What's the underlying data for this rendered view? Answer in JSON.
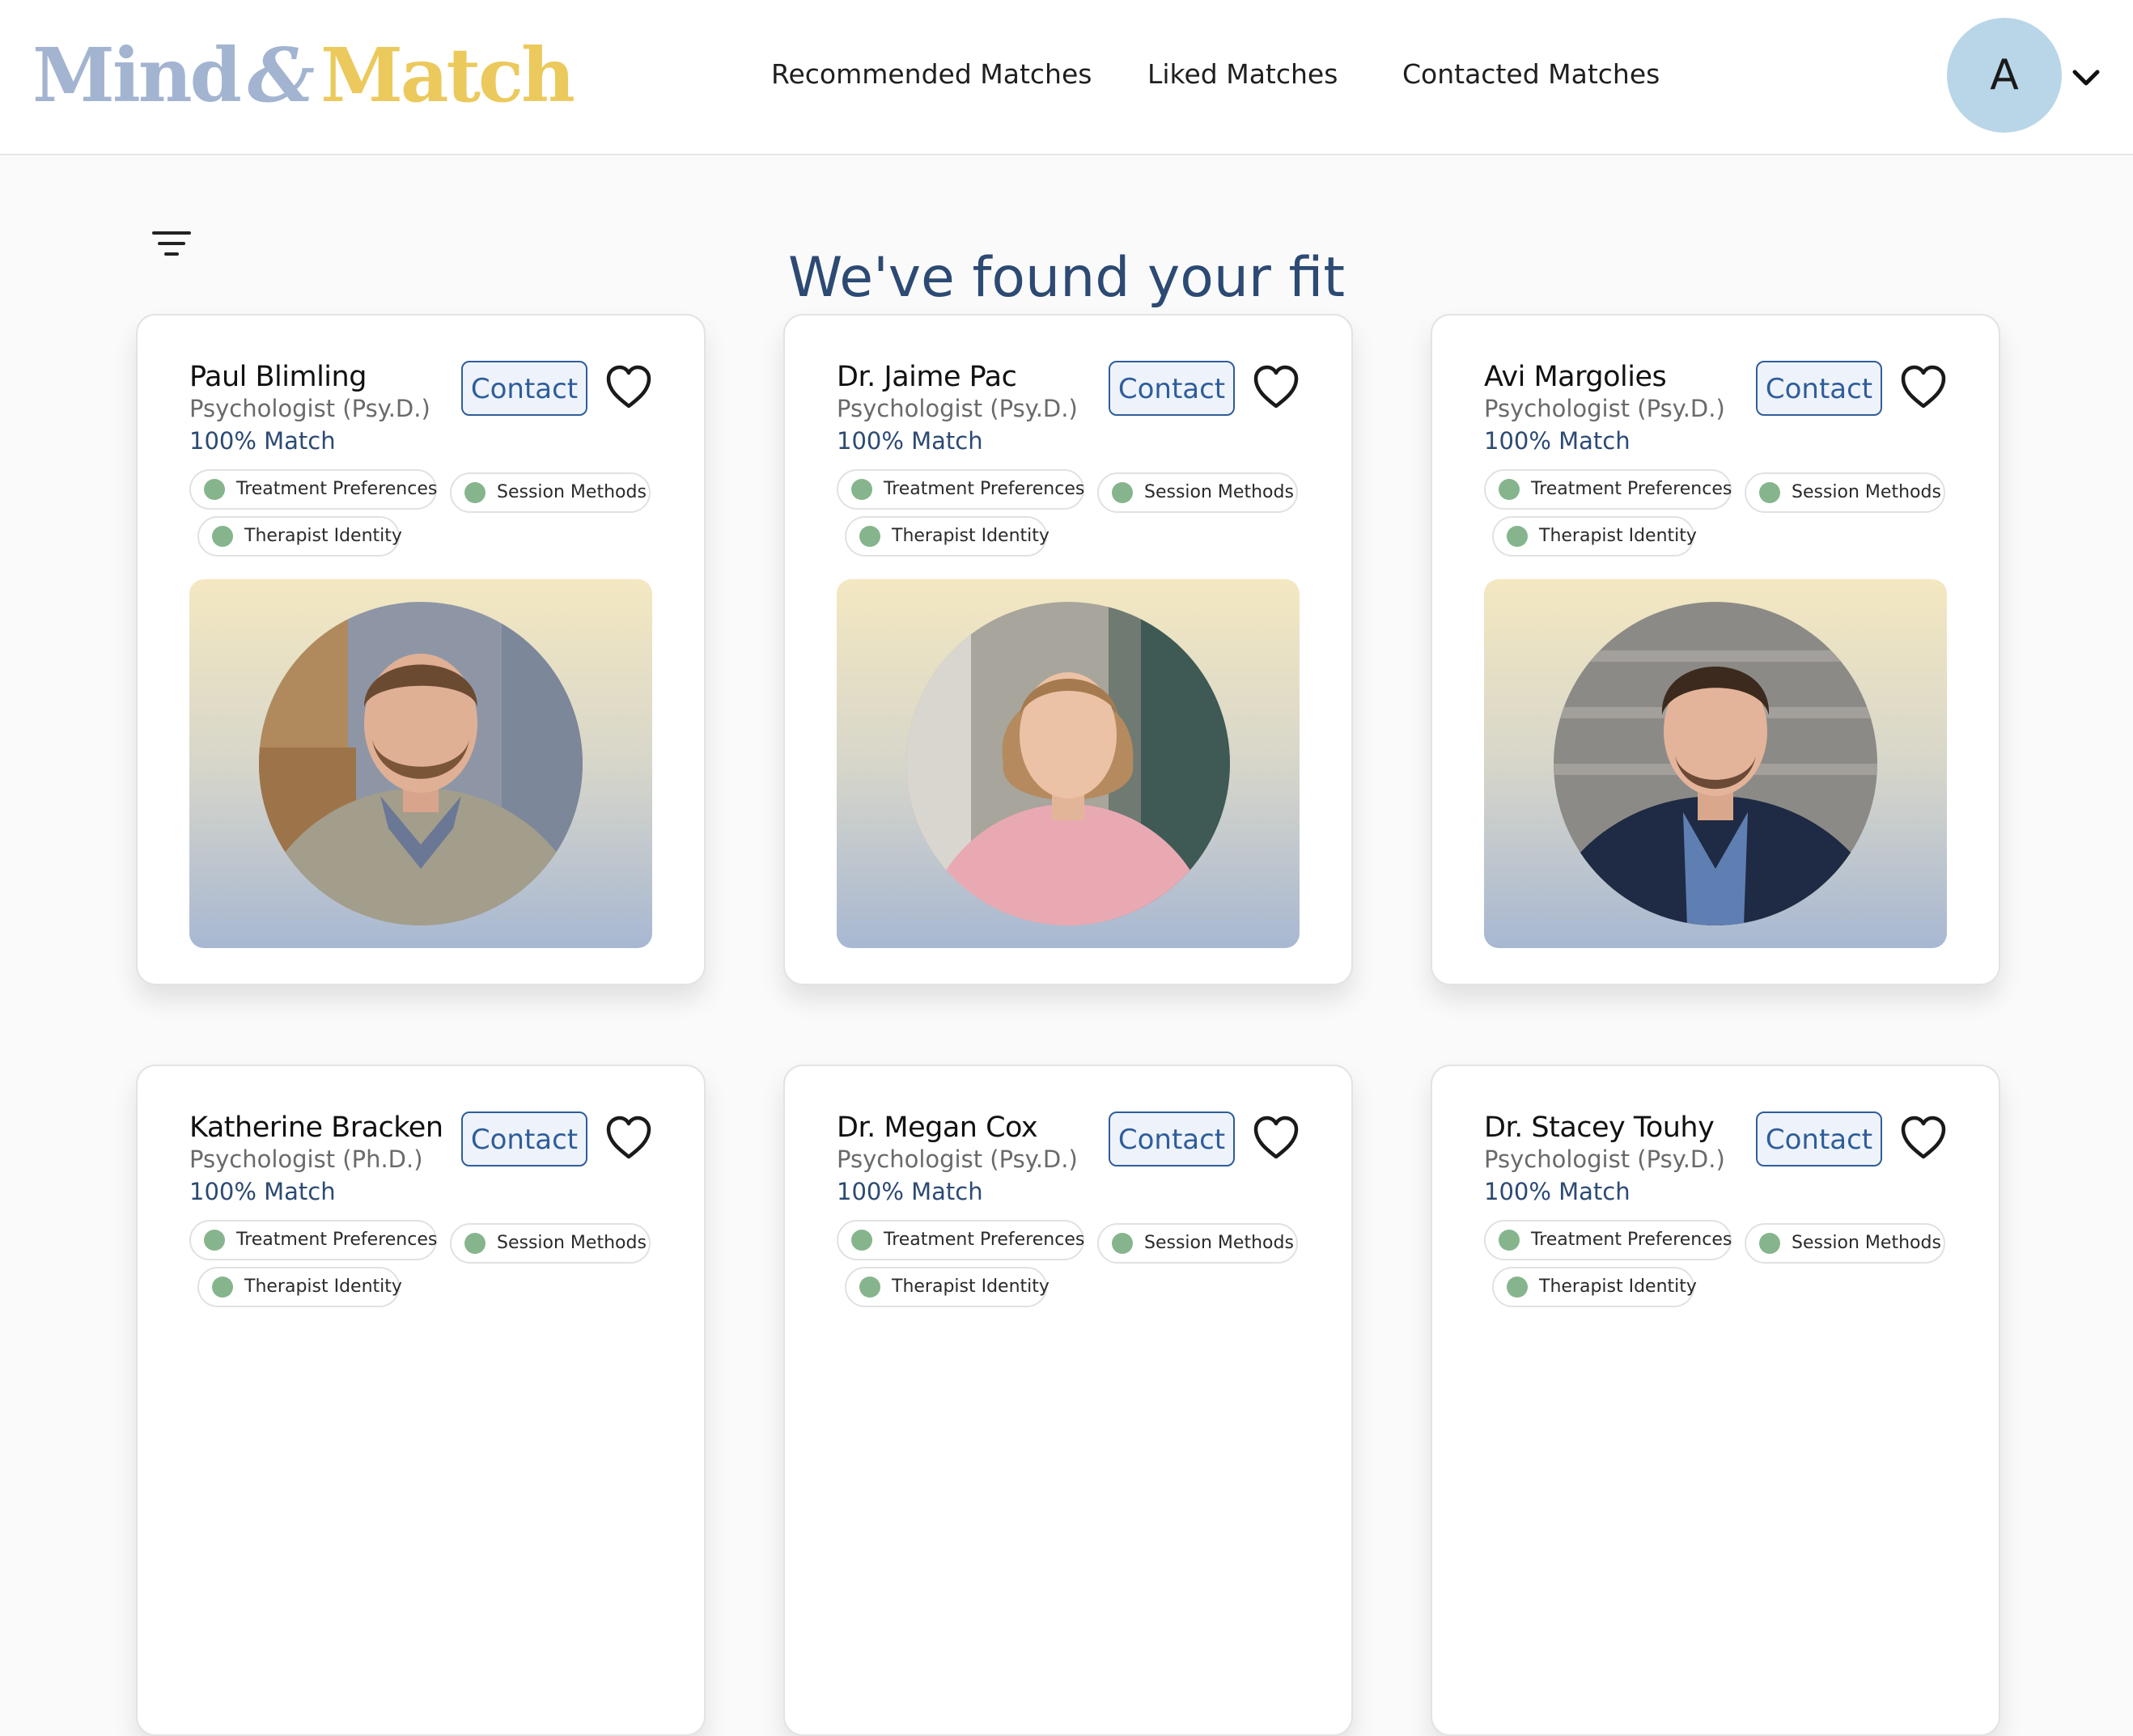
{
  "header": {
    "logo": {
      "part1": "Mind",
      "amp": "&",
      "part2": "Match"
    },
    "nav": [
      "Recommended Matches",
      "Liked Matches",
      "Contacted Matches"
    ],
    "avatar_initial": "A"
  },
  "main": {
    "title": "We've found your fit"
  },
  "contact_label": "Contact",
  "tags": [
    "Treatment Preferences",
    "Session Methods",
    "Therapist Identity"
  ],
  "therapists": [
    {
      "name": "Paul Blimling",
      "credential": "Psychologist (Psy.D.)",
      "match": "100% Match"
    },
    {
      "name": "Dr. Jaime Pac",
      "credential": "Psychologist (Psy.D.)",
      "match": "100% Match"
    },
    {
      "name": "Avi Margolies",
      "credential": "Psychologist (Psy.D.)",
      "match": "100% Match"
    },
    {
      "name": "Katherine Bracken",
      "credential": "Psychologist (Ph.D.)",
      "match": "100% Match"
    },
    {
      "name": "Dr. Megan Cox",
      "credential": "Psychologist (Psy.D.)",
      "match": "100% Match"
    },
    {
      "name": "Dr. Stacey Touhy",
      "credential": "Psychologist (Psy.D.)",
      "match": "100% Match"
    }
  ],
  "colors": {
    "brand_blue": "#a3b4d1",
    "brand_gold": "#ebc95c",
    "title_navy": "#2c4a73",
    "contact_blue": "#2f5d9a",
    "tag_dot_green": "#86b58d",
    "avatar_bg": "#b9d6e8"
  }
}
